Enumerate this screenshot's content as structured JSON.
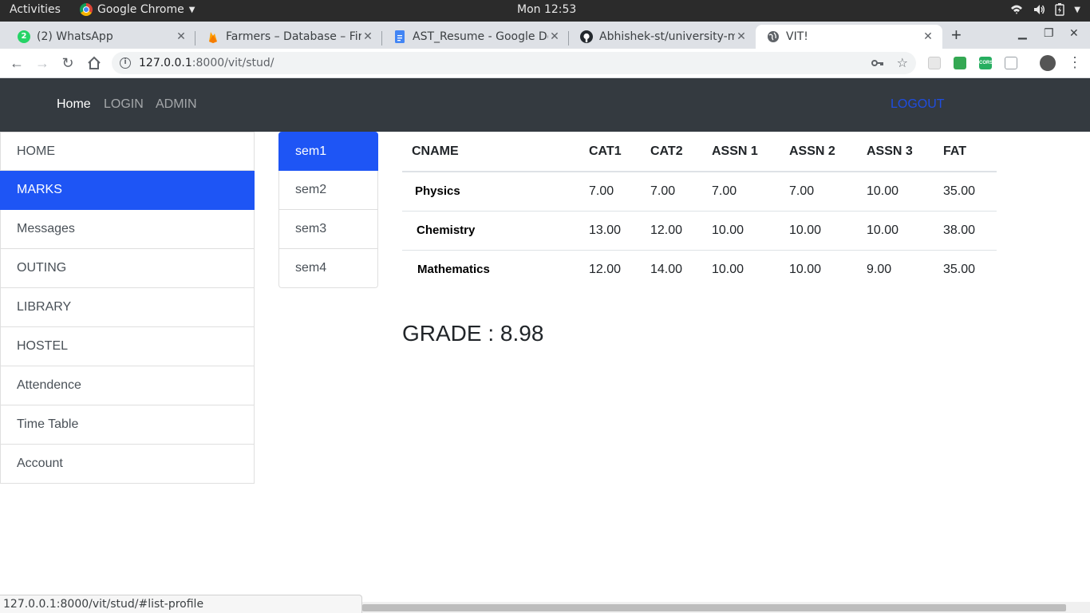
{
  "os_bar": {
    "activities": "Activities",
    "app_name": "Google Chrome",
    "clock": "Mon 12:53"
  },
  "tabs": [
    {
      "title": "(2) WhatsApp",
      "icon": "whatsapp-icon"
    },
    {
      "title": "Farmers – Database – Fire",
      "icon": "firebase-icon"
    },
    {
      "title": "AST_Resume - Google Do",
      "icon": "google-docs-icon"
    },
    {
      "title": "Abhishek-st/university-m",
      "icon": "github-icon"
    },
    {
      "title": "VIT!",
      "icon": "globe-icon",
      "active": true
    }
  ],
  "omnibox": {
    "host": "127.0.0.1",
    "rest": ":8000/vit/stud/"
  },
  "navbar": {
    "home": "Home",
    "login": "LOGIN",
    "admin": "ADMIN",
    "logout": "LOGOUT"
  },
  "sidebar": {
    "items": [
      "HOME",
      "MARKS",
      "Messages",
      "OUTING",
      "LIBRARY",
      "HOSTEL",
      "Attendence",
      "Time Table",
      "Account"
    ],
    "active": "MARKS"
  },
  "semesters": {
    "items": [
      "sem1",
      "sem2",
      "sem3",
      "sem4"
    ],
    "active": "sem1"
  },
  "marks": {
    "headers": [
      "CNAME",
      "CAT1",
      "CAT2",
      "ASSN 1",
      "ASSN 2",
      "ASSN 3",
      "FAT"
    ],
    "rows": [
      [
        "Physics",
        "7.00",
        "7.00",
        "7.00",
        "7.00",
        "10.00",
        "35.00"
      ],
      [
        "Chemistry",
        "13.00",
        "12.00",
        "10.00",
        "10.00",
        "10.00",
        "38.00"
      ],
      [
        "Mathematics",
        "12.00",
        "14.00",
        "10.00",
        "10.00",
        "9.00",
        "35.00"
      ]
    ]
  },
  "grade_text": "GRADE : 8.98",
  "status_url": "127.0.0.1:8000/vit/stud/#list-profile",
  "colors": {
    "primary": "#1e55f5",
    "navbar_bg": "#343a40"
  }
}
